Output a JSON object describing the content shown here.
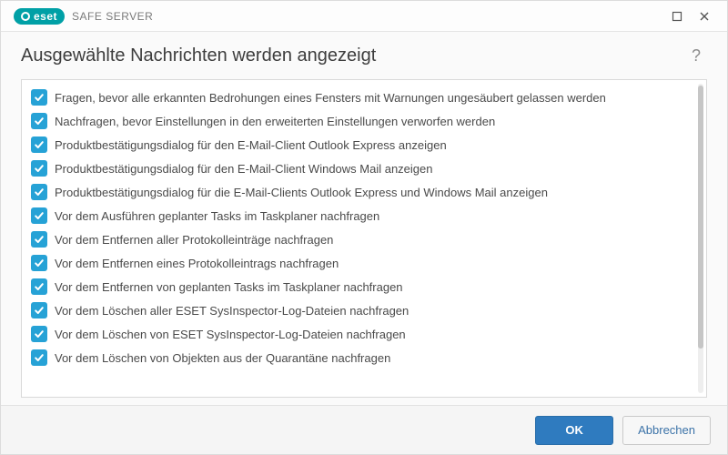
{
  "brand": {
    "badge": "eset",
    "product": "SAFE SERVER"
  },
  "header": {
    "title": "Ausgewählte Nachrichten werden angezeigt"
  },
  "options": [
    {
      "checked": true,
      "label": "Fragen, bevor alle erkannten Bedrohungen eines Fensters mit Warnungen ungesäubert gelassen werden"
    },
    {
      "checked": true,
      "label": "Nachfragen, bevor Einstellungen in den erweiterten Einstellungen verworfen werden"
    },
    {
      "checked": true,
      "label": "Produktbestätigungsdialog für den E-Mail-Client Outlook Express anzeigen"
    },
    {
      "checked": true,
      "label": "Produktbestätigungsdialog für den E-Mail-Client Windows Mail anzeigen"
    },
    {
      "checked": true,
      "label": "Produktbestätigungsdialog für die E-Mail-Clients Outlook Express und Windows Mail anzeigen"
    },
    {
      "checked": true,
      "label": "Vor dem Ausführen geplanter Tasks im Taskplaner nachfragen"
    },
    {
      "checked": true,
      "label": "Vor dem Entfernen aller Protokolleinträge nachfragen"
    },
    {
      "checked": true,
      "label": "Vor dem Entfernen eines Protokolleintrags nachfragen"
    },
    {
      "checked": true,
      "label": "Vor dem Entfernen von geplanten Tasks im Taskplaner nachfragen"
    },
    {
      "checked": true,
      "label": "Vor dem Löschen aller ESET SysInspector-Log-Dateien nachfragen"
    },
    {
      "checked": true,
      "label": "Vor dem Löschen von ESET SysInspector-Log-Dateien nachfragen"
    },
    {
      "checked": true,
      "label": "Vor dem Löschen von Objekten aus der Quarantäne nachfragen"
    }
  ],
  "footer": {
    "ok": "OK",
    "cancel": "Abbrechen"
  },
  "icons": {
    "maximize": "maximize",
    "close": "close",
    "help": "?"
  },
  "colors": {
    "brand_badge_bg": "#00a0a6",
    "checkbox_bg": "#26a2d6",
    "primary_btn_bg": "#2f7bbf"
  }
}
